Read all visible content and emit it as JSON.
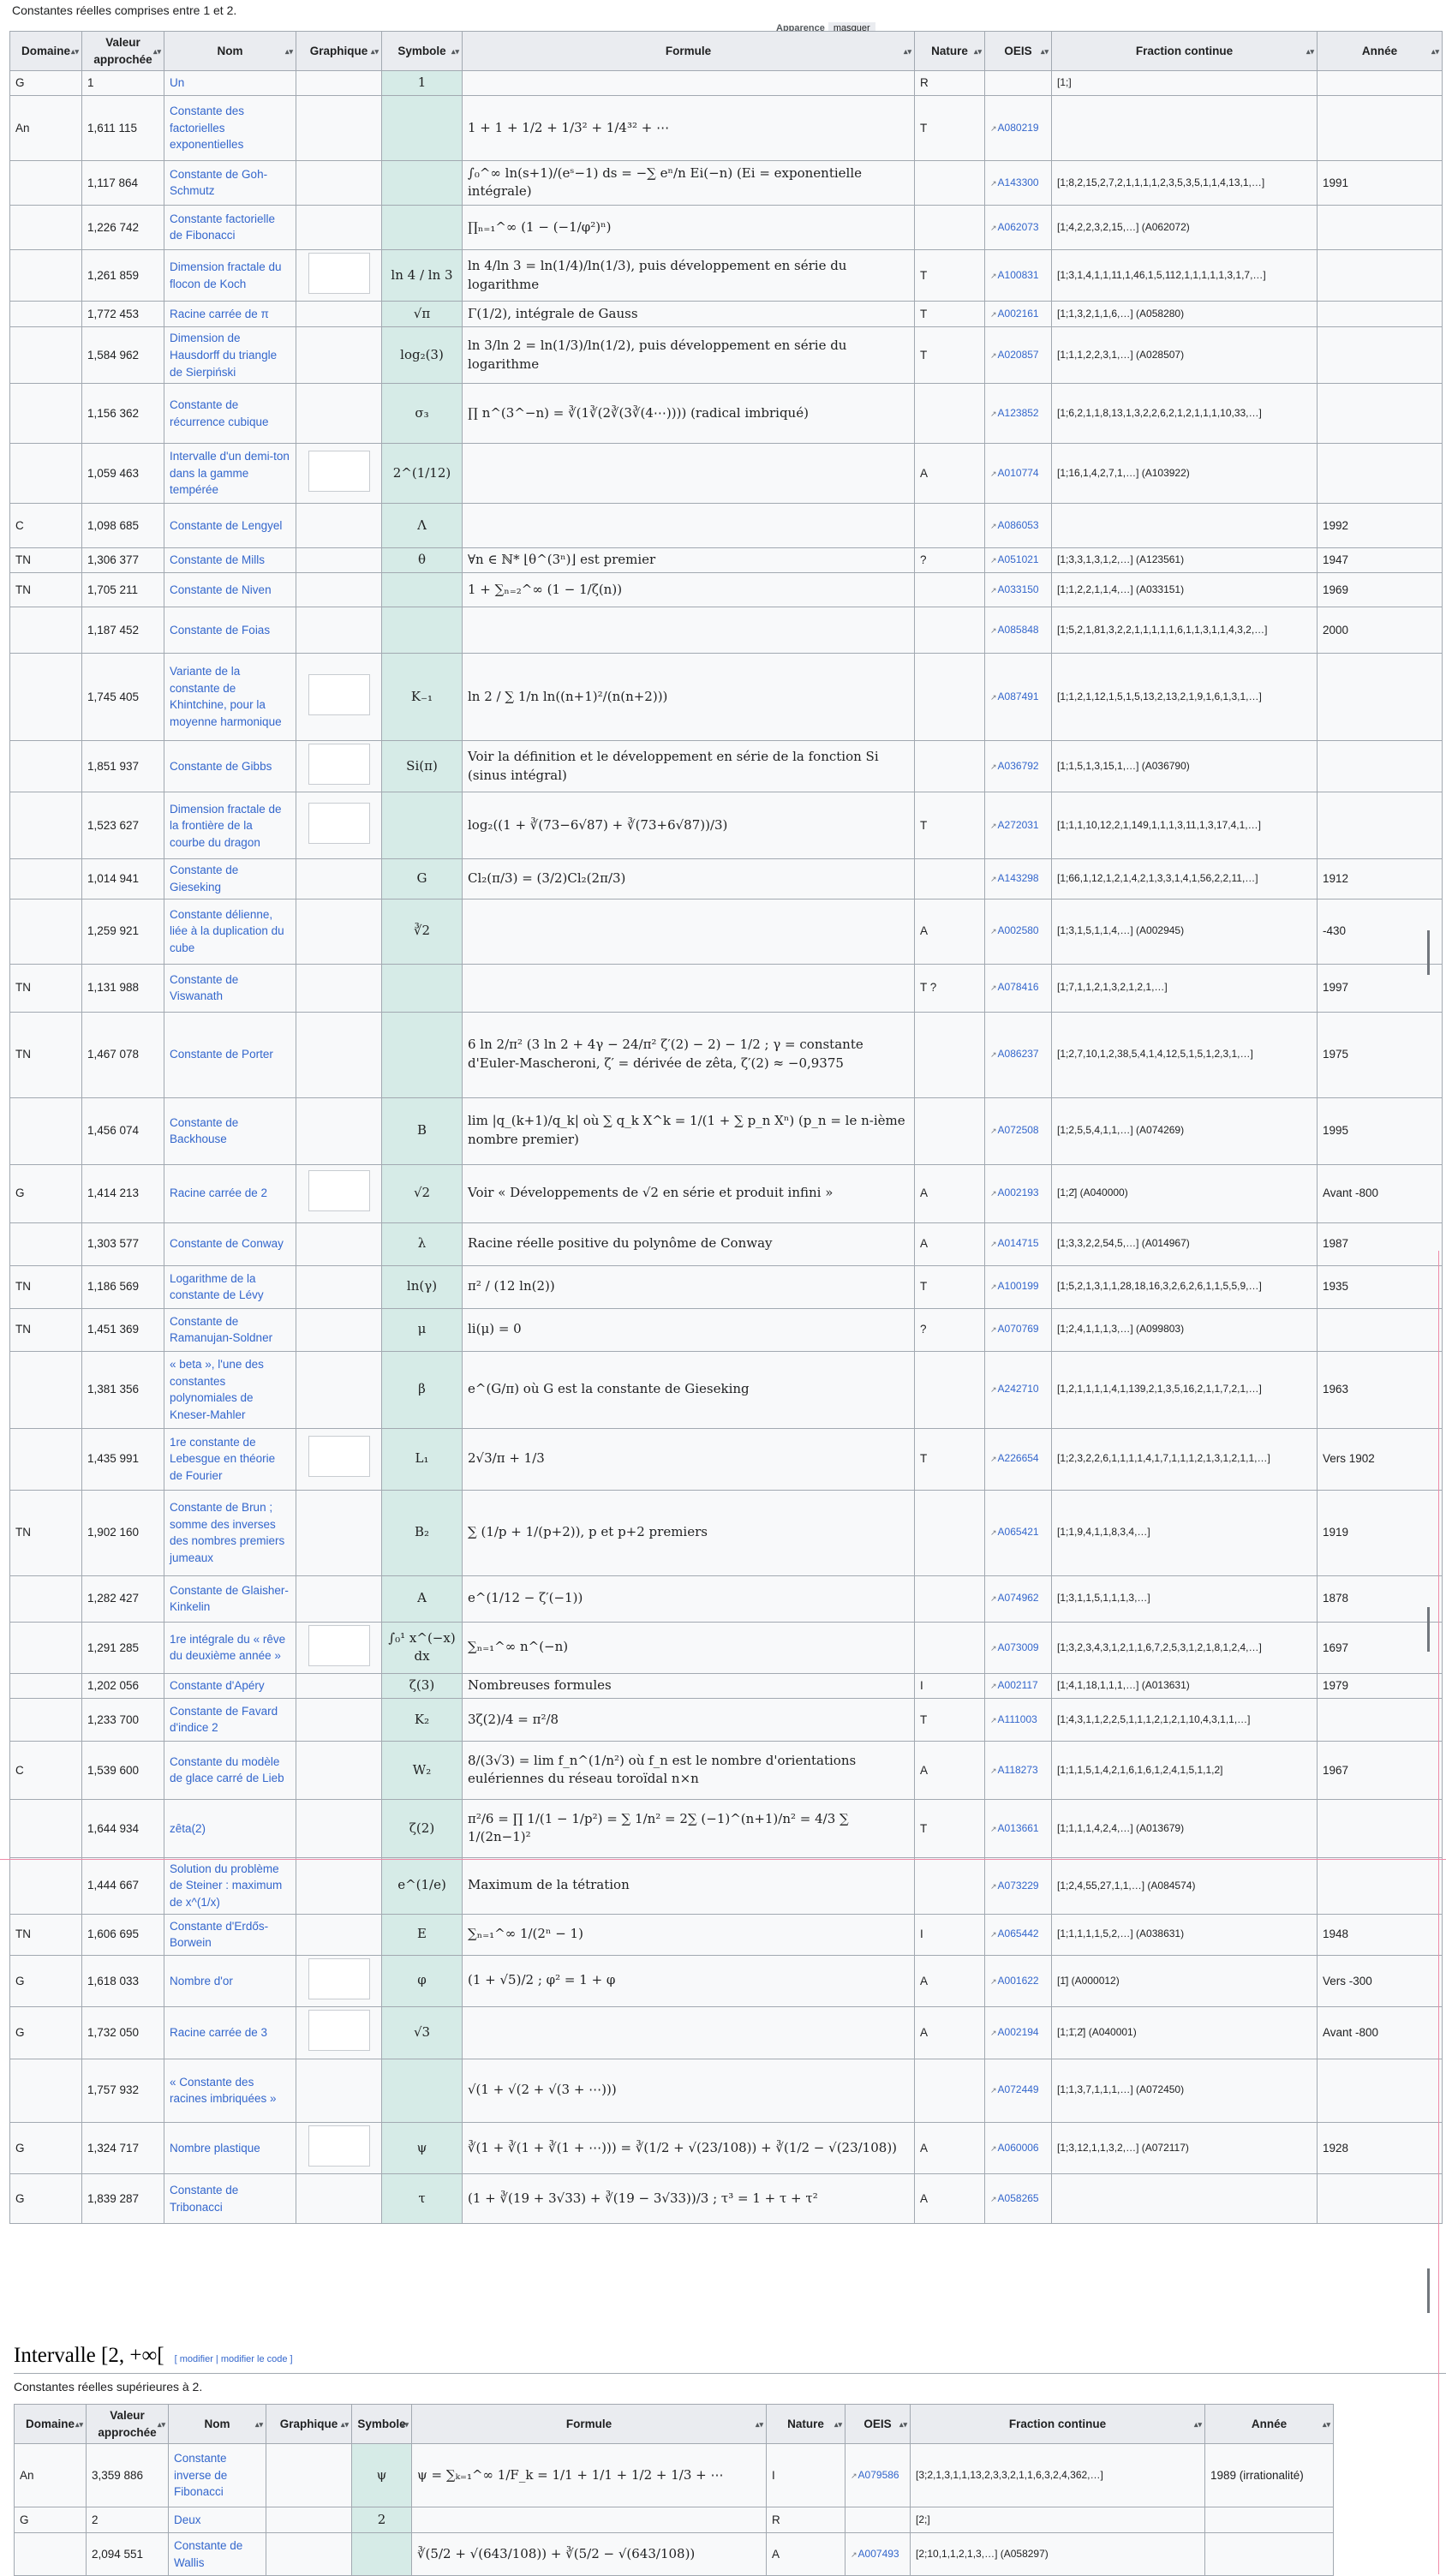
{
  "intro": "Constantes réelles comprises entre 1 et 2.",
  "appearance": {
    "label": "Apparence",
    "mask": "masquer"
  },
  "table1": {
    "headers": [
      "Domaine",
      "Valeur approchée",
      "Nom",
      "Graphique",
      "Symbole",
      "Formule",
      "Nature",
      "OEIS",
      "Fraction continue",
      "Année"
    ],
    "rows": [
      {
        "dom": "G",
        "val": "1",
        "name": "Un",
        "sym": "1",
        "formula": "",
        "nat": "R",
        "oeis": "",
        "frac": "[1;]",
        "year": ""
      },
      {
        "dom": "An",
        "val": "1,611 115",
        "name": "Constante des factorielles exponentielles",
        "sym": "",
        "formula": "1 + 1 + 1/2 + 1/3² + 1/4³² + ⋯",
        "nat": "T",
        "oeis": "A080219",
        "frac": "",
        "year": ""
      },
      {
        "dom": "",
        "val": "1,117 864",
        "name": "Constante de Goh-Schmutz",
        "sym": "",
        "formula": "∫₀^∞ ln(s+1)/(eˢ−1) ds = −∑ eⁿ/n Ei(−n) (Ei = exponentielle intégrale)",
        "nat": "",
        "oeis": "A143300",
        "frac": "[1;8,2,15,2,7,2,1,1,1,1,2,3,5,3,5,1,1,4,13,1,…]",
        "year": "1991"
      },
      {
        "dom": "",
        "val": "1,226 742",
        "name": "Constante factorielle de Fibonacci",
        "sym": "",
        "formula": "∏ₙ₌₁^∞ (1 − (−1/φ²)ⁿ)",
        "nat": "",
        "oeis": "A062073",
        "frac": "[1;4,2,2,3,2,15,…] (A062072)",
        "year": ""
      },
      {
        "dom": "",
        "val": "1,261 859",
        "name": "Dimension fractale du flocon de Koch",
        "sym": "ln 4 / ln 3",
        "formula": "ln 4/ln 3 = ln(1/4)/ln(1/3), puis développement en série du logarithme",
        "nat": "T",
        "oeis": "A100831",
        "frac": "[1;3,1,4,1,1,11,1,46,1,5,112,1,1,1,1,1,3,1,7,…]",
        "year": ""
      },
      {
        "dom": "",
        "val": "1,772 453",
        "name": "Racine carrée de π",
        "sym": "√π",
        "formula": "Γ(1/2), intégrale de Gauss",
        "nat": "T",
        "oeis": "A002161",
        "frac": "[1;1,3,2,1,1,6,…] (A058280)",
        "year": ""
      },
      {
        "dom": "",
        "val": "1,584 962",
        "name": "Dimension de Hausdorff du triangle de Sierpiński",
        "sym": "log₂(3)",
        "formula": "ln 3/ln 2 = ln(1/3)/ln(1/2), puis développement en série du logarithme",
        "nat": "T",
        "oeis": "A020857",
        "frac": "[1;1,1,2,2,3,1,…] (A028507)",
        "year": ""
      },
      {
        "dom": "",
        "val": "1,156 362",
        "name": "Constante de récurrence cubique",
        "sym": "σ₃",
        "formula": "∏ n^(3^−n) = ∛(1∛(2∛(3∛(4⋯)))) (radical imbriqué)",
        "nat": "",
        "oeis": "A123852",
        "frac": "[1;6,2,1,1,8,13,1,3,2,2,6,2,1,2,1,1,1,10,33,…]",
        "year": ""
      },
      {
        "dom": "",
        "val": "1,059 463",
        "name": "Intervalle d'un demi-ton dans la gamme tempérée",
        "sym": "2^(1/12)",
        "formula": "",
        "nat": "A",
        "oeis": "A010774",
        "frac": "[1;16,1,4,2,7,1,…] (A103922)",
        "year": ""
      },
      {
        "dom": "C",
        "val": "1,098 685",
        "name": "Constante de Lengyel",
        "sym": "Λ",
        "formula": "",
        "nat": "",
        "oeis": "A086053",
        "frac": "",
        "year": "1992"
      },
      {
        "dom": "TN",
        "val": "1,306 377",
        "name": "Constante de Mills",
        "sym": "θ",
        "formula": "∀n ∈ ℕ*  ⌊θ^(3ⁿ)⌋ est premier",
        "nat": "?",
        "oeis": "A051021",
        "frac": "[1;3,3,1,3,1,2,…] (A123561)",
        "year": "1947"
      },
      {
        "dom": "TN",
        "val": "1,705 211",
        "name": "Constante de Niven",
        "sym": "",
        "formula": "1 + ∑ₙ₌₂^∞ (1 − 1/ζ(n))",
        "nat": "",
        "oeis": "A033150",
        "frac": "[1;1,2,2,1,1,4,…] (A033151)",
        "year": "1969"
      },
      {
        "dom": "",
        "val": "1,187 452",
        "name": "Constante de Foias",
        "sym": "",
        "formula": "",
        "nat": "",
        "oeis": "A085848",
        "frac": "[1;5,2,1,81,3,2,2,1,1,1,1,1,6,1,1,3,1,1,4,3,2,…]",
        "year": "2000"
      },
      {
        "dom": "",
        "val": "1,745 405",
        "name": "Variante de la constante de Khintchine, pour la moyenne harmonique",
        "sym": "K₋₁",
        "formula": "ln 2 / ∑ 1/n ln((n+1)²/(n(n+2)))",
        "nat": "",
        "oeis": "A087491",
        "frac": "[1;1,2,1,12,1,5,1,5,13,2,13,2,1,9,1,6,1,3,1,…]",
        "year": ""
      },
      {
        "dom": "",
        "val": "1,851 937",
        "name": "Constante de Gibbs",
        "sym": "Si(π)",
        "formula": "Voir la définition et le développement en série de la fonction Si (sinus intégral)",
        "nat": "",
        "oeis": "A036792",
        "frac": "[1;1,5,1,3,15,1,…] (A036790)",
        "year": ""
      },
      {
        "dom": "",
        "val": "1,523 627",
        "name": "Dimension fractale de la frontière de la courbe du dragon",
        "sym": "",
        "formula": "log₂((1 + ∛(73−6√87) + ∛(73+6√87))/3)",
        "nat": "T",
        "oeis": "A272031",
        "frac": "[1;1,1,10,12,2,1,149,1,1,1,3,11,1,3,17,4,1,…]",
        "year": ""
      },
      {
        "dom": "",
        "val": "1,014 941",
        "name": "Constante de Gieseking",
        "sym": "G",
        "formula": "Cl₂(π/3) = (3/2)Cl₂(2π/3)",
        "nat": "",
        "oeis": "A143298",
        "frac": "[1;66,1,12,1,2,1,4,2,1,3,3,1,4,1,56,2,2,11,…]",
        "year": "1912"
      },
      {
        "dom": "",
        "val": "1,259 921",
        "name": "Constante délienne, liée à la duplication du cube",
        "sym": "∛2",
        "formula": "",
        "nat": "A",
        "oeis": "A002580",
        "frac": "[1;3,1,5,1,1,4,…] (A002945)",
        "year": "-430"
      },
      {
        "dom": "TN",
        "val": "1,131 988",
        "name": "Constante de Viswanath",
        "sym": "",
        "formula": "",
        "nat": "T ?",
        "oeis": "A078416",
        "frac": "[1;7,1,1,2,1,3,2,1,2,1,…]",
        "year": "1997"
      },
      {
        "dom": "TN",
        "val": "1,467 078",
        "name": "Constante de Porter",
        "sym": "",
        "formula": "6 ln 2/π² (3 ln 2 + 4γ − 24/π² ζ′(2) − 2) − 1/2 ; γ = constante d'Euler-Mascheroni, ζ′ = dérivée de zêta, ζ′(2) ≈ −0,9375",
        "nat": "",
        "oeis": "A086237",
        "frac": "[1;2,7,10,1,2,38,5,4,1,4,12,5,1,5,1,2,3,1,…]",
        "year": "1975"
      },
      {
        "dom": "",
        "val": "1,456 074",
        "name": "Constante de Backhouse",
        "sym": "B",
        "formula": "lim |q_(k+1)/q_k| où ∑ q_k X^k = 1/(1 + ∑ p_n Xⁿ) (p_n = le n-ième nombre premier)",
        "nat": "",
        "oeis": "A072508",
        "frac": "[1;2,5,5,4,1,1,…] (A074269)",
        "year": "1995"
      },
      {
        "dom": "G",
        "val": "1,414 213",
        "name": "Racine carrée de 2",
        "sym": "√2",
        "formula": "Voir « Développements de √2 en série et produit infini »",
        "nat": "A",
        "oeis": "A002193",
        "frac": "[1;2̄] (A040000)",
        "year": "Avant -800"
      },
      {
        "dom": "",
        "val": "1,303 577",
        "name": "Constante de Conway",
        "sym": "λ",
        "formula": "Racine réelle positive du polynôme de Conway",
        "nat": "A",
        "oeis": "A014715",
        "frac": "[1;3,3,2,2,54,5,…] (A014967)",
        "year": "1987"
      },
      {
        "dom": "TN",
        "val": "1,186 569",
        "name": "Logarithme de la constante de Lévy",
        "sym": "ln(γ)",
        "formula": "π² / (12 ln(2))",
        "nat": "T",
        "oeis": "A100199",
        "frac": "[1;5,2,1,3,1,1,28,18,16,3,2,6,2,6,1,1,5,5,9,…]",
        "year": "1935"
      },
      {
        "dom": "TN",
        "val": "1,451 369",
        "name": "Constante de Ramanujan-Soldner",
        "sym": "μ",
        "formula": "li(μ) = 0",
        "nat": "?",
        "oeis": "A070769",
        "frac": "[1;2,4,1,1,1,3,…] (A099803)",
        "year": ""
      },
      {
        "dom": "",
        "val": "1,381 356",
        "name": "« beta », l'une des constantes polynomiales de Kneser-Mahler",
        "sym": "β",
        "formula": "e^(G/π) où G est la constante de Gieseking",
        "nat": "",
        "oeis": "A242710",
        "frac": "[1,2,1,1,1,1,4,1,139,2,1,3,5,16,2,1,1,7,2,1,…]",
        "year": "1963"
      },
      {
        "dom": "",
        "val": "1,435 991",
        "name": "1re constante de Lebesgue en théorie de Fourier",
        "sym": "L₁",
        "formula": "2√3/π + 1/3",
        "nat": "T",
        "oeis": "A226654",
        "frac": "[1;2,3,2,2,6,1,1,1,1,4,1,7,1,1,1,2,1,3,1,2,1,1,…]",
        "year": "Vers 1902"
      },
      {
        "dom": "TN",
        "val": "1,902 160",
        "name": "Constante de Brun ; somme des inverses des nombres premiers jumeaux",
        "sym": "B₂",
        "formula": "∑ (1/p + 1/(p+2)), p et p+2 premiers",
        "nat": "",
        "oeis": "A065421",
        "frac": "[1;1,9,4,1,1,8,3,4,…]",
        "year": "1919"
      },
      {
        "dom": "",
        "val": "1,282 427",
        "name": "Constante de Glaisher-Kinkelin",
        "sym": "A",
        "formula": "e^(1/12 − ζ′(−1))",
        "nat": "",
        "oeis": "A074962",
        "frac": "[1;3,1,1,5,1,1,1,3,…]",
        "year": "1878"
      },
      {
        "dom": "",
        "val": "1,291 285",
        "name": "1re intégrale du « rêve du deuxième année »",
        "sym": "∫₀¹ x^(−x) dx",
        "formula": "∑ₙ₌₁^∞ n^(−n)",
        "nat": "",
        "oeis": "A073009",
        "frac": "[1;3,2,3,4,3,1,2,1,1,6,7,2,5,3,1,2,1,8,1,2,4,…]",
        "year": "1697"
      },
      {
        "dom": "",
        "val": "1,202 056",
        "name": "Constante d'Apéry",
        "sym": "ζ(3)",
        "formula": "Nombreuses formules",
        "nat": "I",
        "oeis": "A002117",
        "frac": "[1;4,1,18,1,1,1,…] (A013631)",
        "year": "1979"
      },
      {
        "dom": "",
        "val": "1,233 700",
        "name": "Constante de Favard d'indice 2",
        "sym": "K₂",
        "formula": "3ζ(2)/4 = π²/8",
        "nat": "T",
        "oeis": "A111003",
        "frac": "[1;4,3,1,1,2,2,5,1,1,1,2,1,2,1,10,4,3,1,1,…]",
        "year": ""
      },
      {
        "dom": "C",
        "val": "1,539 600",
        "name": "Constante du modèle de glace carré de Lieb",
        "sym": "W₂",
        "formula": "8/(3√3) = lim f_n^(1/n²) où f_n est le nombre d'orientations eulériennes du réseau toroïdal n×n",
        "nat": "A",
        "oeis": "A118273",
        "frac": "[1;1,1,5,1,4,2,1,6,1,6,1,2,4,1,5,1,1,2]",
        "year": "1967"
      },
      {
        "dom": "",
        "val": "1,644 934",
        "name": "zêta(2)",
        "sym": "ζ(2)",
        "formula": "π²/6 = ∏ 1/(1 − 1/p²) = ∑ 1/n² = 2∑ (−1)^(n+1)/n² = 4/3 ∑ 1/(2n−1)²",
        "nat": "T",
        "oeis": "A013661",
        "frac": "[1;1,1,1,4,2,4,…] (A013679)",
        "year": ""
      },
      {
        "dom": "",
        "val": "1,444 667",
        "name": "Solution du problème de Steiner : maximum de x^(1/x)",
        "sym": "e^(1/e)",
        "formula": "Maximum de la tétration",
        "nat": "",
        "oeis": "A073229",
        "frac": "[1;2,4,55,27,1,1,…] (A084574)",
        "year": ""
      },
      {
        "dom": "TN",
        "val": "1,606 695",
        "name": "Constante d'Erdős-Borwein",
        "sym": "E",
        "formula": "∑ₙ₌₁^∞ 1/(2ⁿ − 1)",
        "nat": "I",
        "oeis": "A065442",
        "frac": "[1;1,1,1,1,5,2,…] (A038631)",
        "year": "1948"
      },
      {
        "dom": "G",
        "val": "1,618 033",
        "name": "Nombre d'or",
        "sym": "φ",
        "formula": "(1 + √5)/2 ; φ² = 1 + φ",
        "nat": "A",
        "oeis": "A001622",
        "frac": "[1̄] (A000012)",
        "year": "Vers -300"
      },
      {
        "dom": "G",
        "val": "1,732 050",
        "name": "Racine carrée de 3",
        "sym": "√3",
        "formula": "",
        "nat": "A",
        "oeis": "A002194",
        "frac": "[1;1̄,2̄] (A040001)",
        "year": "Avant -800"
      },
      {
        "dom": "",
        "val": "1,757 932",
        "name": "« Constante des racines imbriquées »",
        "sym": "",
        "formula": "√(1 + √(2 + √(3 + ⋯)))",
        "nat": "",
        "oeis": "A072449",
        "frac": "[1;1,3,7,1,1,1,…] (A072450)",
        "year": ""
      },
      {
        "dom": "G",
        "val": "1,324 717",
        "name": "Nombre plastique",
        "sym": "ψ",
        "formula": "∛(1 + ∛(1 + ∛(1 + ⋯))) = ∛(1/2 + √(23/108)) + ∛(1/2 − √(23/108))",
        "nat": "A",
        "oeis": "A060006",
        "frac": "[1;3,12,1,1,3,2,…] (A072117)",
        "year": "1928"
      },
      {
        "dom": "G",
        "val": "1,839 287",
        "name": "Constante de Tribonacci",
        "sym": "τ",
        "formula": "(1 + ∛(19 + 3√33) + ∛(19 − 3√33))/3 ; τ³ = 1 + τ + τ²",
        "nat": "A",
        "oeis": "A058265",
        "frac": "",
        "year": ""
      }
    ]
  },
  "section2": {
    "title": "Intervalle [2, +∞[",
    "edit1": "modifier",
    "edit2": "modifier le code",
    "intro": "Constantes réelles supérieures à 2.",
    "headers": [
      "Domaine",
      "Valeur approchée",
      "Nom",
      "Graphique",
      "Symbole",
      "Formule",
      "Nature",
      "OEIS",
      "Fraction continue",
      "Année"
    ],
    "rows": [
      {
        "dom": "An",
        "val": "3,359 886",
        "name": "Constante inverse de Fibonacci",
        "sym": "ψ",
        "formula": "ψ = ∑ₖ₌₁^∞ 1/F_k = 1/1 + 1/1 + 1/2 + 1/3 + ⋯",
        "nat": "I",
        "oeis": "A079586",
        "frac": "[3;2,1,3,1,1,13,2,3,3,2,1,1,6,3,2,4,362,…]",
        "year": "1989 (irrationalité)"
      },
      {
        "dom": "G",
        "val": "2",
        "name": "Deux",
        "sym": "2",
        "formula": "",
        "nat": "R",
        "oeis": "",
        "frac": "[2;]",
        "year": ""
      },
      {
        "dom": "",
        "val": "2,094 551",
        "name": "Constante de Wallis",
        "sym": "",
        "formula": "∛(5/2 + √(643/108)) + ∛(5/2 − √(643/108))",
        "nat": "A",
        "oeis": "A007493",
        "frac": "[2;10,1,1,2,1,3,…] (A058297)",
        "year": ""
      }
    ]
  }
}
